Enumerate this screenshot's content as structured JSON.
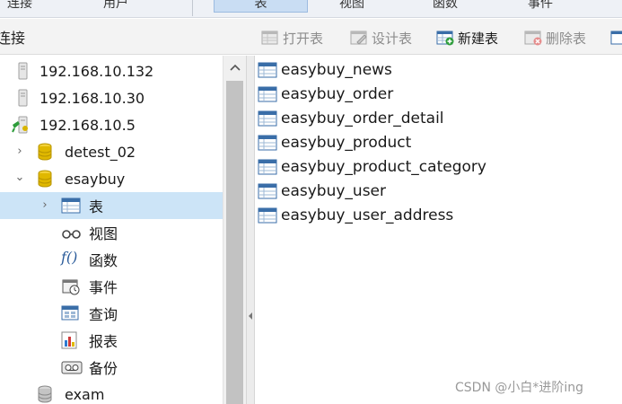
{
  "top_toolbar": {
    "items": [
      "连接",
      "用户",
      "表",
      "视图",
      "函数",
      "事件"
    ],
    "active": "表"
  },
  "connections_header": {
    "title": "连接"
  },
  "object_toolbar": {
    "open_table": "打开表",
    "design_table": "设计表",
    "new_table": "新建表",
    "delete_table": "删除表"
  },
  "tree": {
    "connections": [
      {
        "label": "192.168.10.132"
      },
      {
        "label": "192.168.10.30"
      },
      {
        "label": "192.168.10.5"
      }
    ],
    "databases": [
      {
        "label": "detest_02"
      },
      {
        "label": "esaybuy"
      }
    ],
    "object_types": [
      {
        "label": "表"
      },
      {
        "label": "视图"
      },
      {
        "label": "函数"
      },
      {
        "label": "事件"
      },
      {
        "label": "查询"
      },
      {
        "label": "报表"
      },
      {
        "label": "备份"
      }
    ],
    "more_databases": [
      {
        "label": "exam"
      }
    ],
    "function_glyph": "f()"
  },
  "tables": [
    "easybuy_news",
    "easybuy_order",
    "easybuy_order_detail",
    "easybuy_product",
    "easybuy_product_category",
    "easybuy_user",
    "easybuy_user_address"
  ],
  "watermark": "CSDN @小白*进阶ing",
  "colors": {
    "selection": "#cce4f7",
    "db_icon": "#e0b800",
    "table_icon": "#3a6ea8"
  }
}
